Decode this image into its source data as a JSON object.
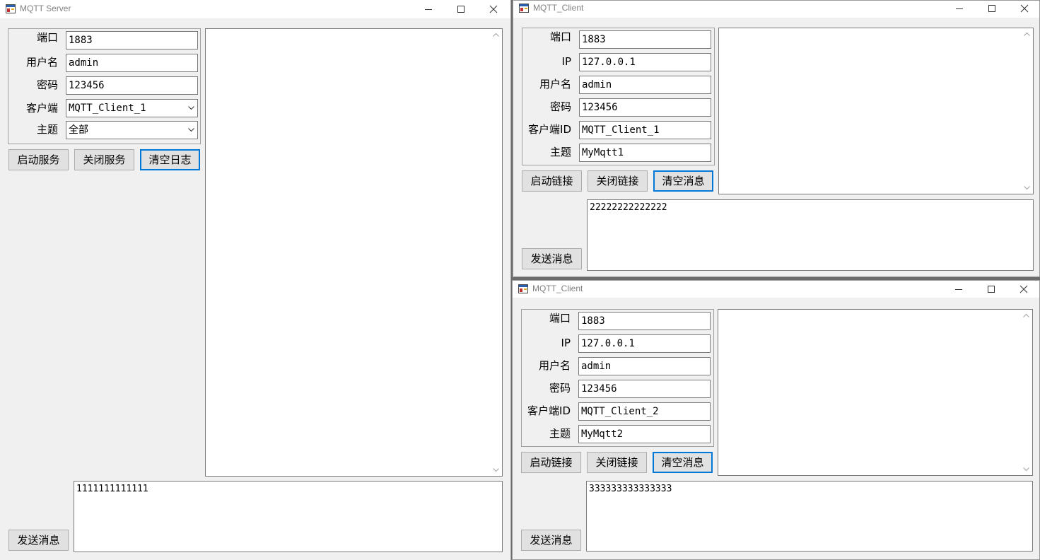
{
  "server": {
    "title": "MQTT Server",
    "fields": {
      "port_label": "端口",
      "port_value": "1883",
      "user_label": "用户名",
      "user_value": "admin",
      "pass_label": "密码",
      "pass_value": "123456",
      "client_label": "客户端",
      "client_value": "MQTT_Client_1",
      "topic_label": "主题",
      "topic_value": "全部"
    },
    "buttons": {
      "start": "启动服务",
      "stop": "关闭服务",
      "clear": "清空日志",
      "send": "发送消息"
    },
    "log_text": "",
    "message_text": "1111111111111"
  },
  "client1": {
    "title": "MQTT_Client",
    "fields": {
      "port_label": "端口",
      "port_value": "1883",
      "ip_label": "IP",
      "ip_value": "127.0.0.1",
      "user_label": "用户名",
      "user_value": "admin",
      "pass_label": "密码",
      "pass_value": "123456",
      "id_label": "客户端ID",
      "id_value": "MQTT_Client_1",
      "topic_label": "主题",
      "topic_value": "MyMqtt1"
    },
    "buttons": {
      "connect": "启动链接",
      "disconnect": "关闭链接",
      "clear": "清空消息",
      "send": "发送消息"
    },
    "log_text": "",
    "message_text": "22222222222222"
  },
  "client2": {
    "title": "MQTT_Client",
    "fields": {
      "port_label": "端口",
      "port_value": "1883",
      "ip_label": "IP",
      "ip_value": "127.0.0.1",
      "user_label": "用户名",
      "user_value": "admin",
      "pass_label": "密码",
      "pass_value": "123456",
      "id_label": "客户端ID",
      "id_value": "MQTT_Client_2",
      "topic_label": "主题",
      "topic_value": "MyMqtt2"
    },
    "buttons": {
      "connect": "启动链接",
      "disconnect": "关闭链接",
      "clear": "清空消息",
      "send": "发送消息"
    },
    "log_text": "",
    "message_text": "333333333333333"
  },
  "colors": {
    "focus_border": "#0078d7",
    "window_bg": "#f0f0f0",
    "button_bg": "#e1e1e1"
  },
  "icons": [
    "app-icon",
    "minimize-icon",
    "maximize-icon",
    "close-icon",
    "chevron-down-icon",
    "scroll-up-icon",
    "scroll-down-icon"
  ]
}
